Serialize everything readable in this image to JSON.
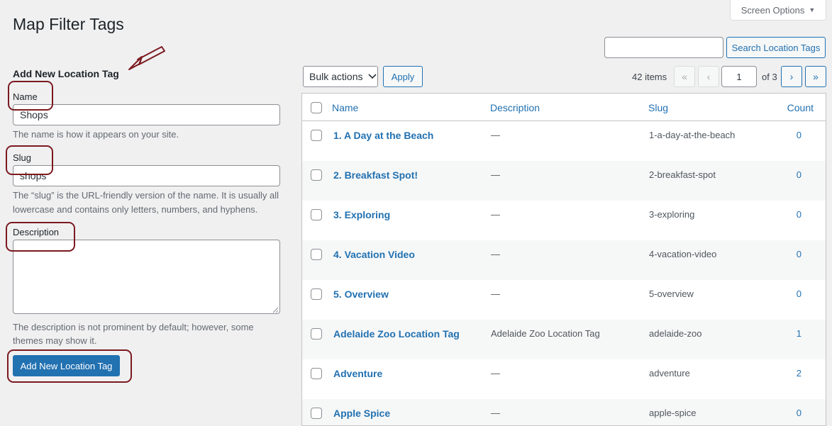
{
  "screen_options": {
    "label": "Screen Options",
    "caret": "▼"
  },
  "page_title": "Map Filter Tags",
  "search": {
    "value": "",
    "button": "Search Location Tags"
  },
  "form": {
    "heading": "Add New Location Tag",
    "name_label": "Name",
    "name_value": "Shops",
    "name_help": "The name is how it appears on your site.",
    "slug_label": "Slug",
    "slug_value": "shops",
    "slug_help_1": "The “slug” is the URL-friendly version of the name. It is usually all",
    "slug_help_2": "lowercase and contains only letters, numbers, and hyphens.",
    "description_label": "Description",
    "description_value": "",
    "description_help_1": "The description is not prominent by default; however, some",
    "description_help_2": "themes may show it.",
    "submit": "Add New Location Tag"
  },
  "bulk": {
    "selected": "Bulk actions",
    "apply": "Apply"
  },
  "pagination": {
    "items": "42 items",
    "first": "«",
    "prev": "‹",
    "current": "1",
    "of": "of 3",
    "next": "›",
    "last": "»"
  },
  "table": {
    "headers": {
      "name": "Name",
      "description": "Description",
      "slug": "Slug",
      "count": "Count"
    },
    "rows": [
      {
        "name": "1. A Day at the Beach",
        "description": "—",
        "slug": "1-a-day-at-the-beach",
        "count": "0"
      },
      {
        "name": "2. Breakfast Spot!",
        "description": "—",
        "slug": "2-breakfast-spot",
        "count": "0"
      },
      {
        "name": "3. Exploring",
        "description": "—",
        "slug": "3-exploring",
        "count": "0"
      },
      {
        "name": "4. Vacation Video",
        "description": "—",
        "slug": "4-vacation-video",
        "count": "0"
      },
      {
        "name": "5. Overview",
        "description": "—",
        "slug": "5-overview",
        "count": "0"
      },
      {
        "name": "Adelaide Zoo Location Tag",
        "description": "Adelaide Zoo Location Tag",
        "slug": "adelaide-zoo",
        "count": "1"
      },
      {
        "name": "Adventure",
        "description": "—",
        "slug": "adventure",
        "count": "2"
      },
      {
        "name": "Apple Spice",
        "description": "—",
        "slug": "apple-spice",
        "count": "0"
      }
    ]
  },
  "colors": {
    "annotation": "#7b1a1f",
    "primary": "#2271b1"
  }
}
